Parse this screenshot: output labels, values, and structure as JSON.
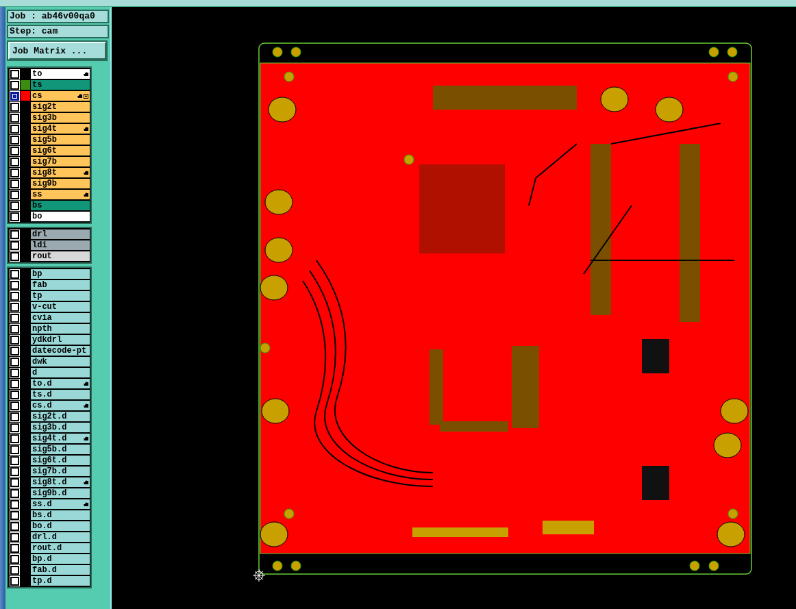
{
  "job": "Job : ab46v00qa0",
  "step": "Step: cam",
  "matrix_button": "Job Matrix ...",
  "layer_groups": [
    {
      "layers": [
        {
          "name": "to",
          "kind": "silk",
          "selected": false,
          "marked": true
        },
        {
          "name": "ts",
          "kind": "mask",
          "selected": false,
          "marked": false,
          "color": "#3c8c12"
        },
        {
          "name": "cs",
          "kind": "signal",
          "selected": true,
          "marked": true,
          "expandable": true,
          "color": "#ff0000"
        },
        {
          "name": "sig2t",
          "kind": "signal",
          "selected": false,
          "marked": false
        },
        {
          "name": "sig3b",
          "kind": "signal",
          "selected": false,
          "marked": false
        },
        {
          "name": "sig4t",
          "kind": "signal",
          "selected": false,
          "marked": true
        },
        {
          "name": "sig5b",
          "kind": "signal",
          "selected": false,
          "marked": false
        },
        {
          "name": "sig6t",
          "kind": "signal",
          "selected": false,
          "marked": false
        },
        {
          "name": "sig7b",
          "kind": "signal",
          "selected": false,
          "marked": false
        },
        {
          "name": "sig8t",
          "kind": "signal",
          "selected": false,
          "marked": true
        },
        {
          "name": "sig9b",
          "kind": "signal",
          "selected": false,
          "marked": false
        },
        {
          "name": "ss",
          "kind": "signal",
          "selected": false,
          "marked": true
        },
        {
          "name": "bs",
          "kind": "mask",
          "selected": false,
          "marked": false
        },
        {
          "name": "bo",
          "kind": "silk",
          "selected": false,
          "marked": false
        }
      ]
    },
    {
      "layers": [
        {
          "name": "drl",
          "kind": "drill",
          "selected": false,
          "marked": false
        },
        {
          "name": "ldi",
          "kind": "drill",
          "selected": false,
          "marked": false
        },
        {
          "name": "rout",
          "kind": "rout",
          "selected": false,
          "marked": false
        }
      ]
    },
    {
      "layers": [
        {
          "name": "bp",
          "kind": "misc",
          "selected": false,
          "marked": false
        },
        {
          "name": "fab",
          "kind": "misc",
          "selected": false,
          "marked": false
        },
        {
          "name": "tp",
          "kind": "misc",
          "selected": false,
          "marked": false
        },
        {
          "name": "v-cut",
          "kind": "misc",
          "selected": false,
          "marked": false
        },
        {
          "name": "cvia",
          "kind": "misc",
          "selected": false,
          "marked": false
        },
        {
          "name": "npth",
          "kind": "misc",
          "selected": false,
          "marked": false
        },
        {
          "name": "ydkdrl",
          "kind": "misc",
          "selected": false,
          "marked": false
        },
        {
          "name": "datecode-pt",
          "kind": "misc",
          "selected": false,
          "marked": false
        },
        {
          "name": "dwk",
          "kind": "misc",
          "selected": false,
          "marked": false
        },
        {
          "name": "d",
          "kind": "misc",
          "selected": false,
          "marked": false
        },
        {
          "name": "to.d",
          "kind": "misc",
          "selected": false,
          "marked": true
        },
        {
          "name": "ts.d",
          "kind": "misc",
          "selected": false,
          "marked": false
        },
        {
          "name": "cs.d",
          "kind": "misc",
          "selected": false,
          "marked": true
        },
        {
          "name": "sig2t.d",
          "kind": "misc",
          "selected": false,
          "marked": false
        },
        {
          "name": "sig3b.d",
          "kind": "misc",
          "selected": false,
          "marked": false
        },
        {
          "name": "sig4t.d",
          "kind": "misc",
          "selected": false,
          "marked": true
        },
        {
          "name": "sig5b.d",
          "kind": "misc",
          "selected": false,
          "marked": false
        },
        {
          "name": "sig6t.d",
          "kind": "misc",
          "selected": false,
          "marked": false
        },
        {
          "name": "sig7b.d",
          "kind": "misc",
          "selected": false,
          "marked": false
        },
        {
          "name": "sig8t.d",
          "kind": "misc",
          "selected": false,
          "marked": true
        },
        {
          "name": "sig9b.d",
          "kind": "misc",
          "selected": false,
          "marked": false
        },
        {
          "name": "ss.d",
          "kind": "misc",
          "selected": false,
          "marked": true
        },
        {
          "name": "bs.d",
          "kind": "misc",
          "selected": false,
          "marked": false
        },
        {
          "name": "bo.d",
          "kind": "misc",
          "selected": false,
          "marked": false
        },
        {
          "name": "drl.d",
          "kind": "misc",
          "selected": false,
          "marked": false
        },
        {
          "name": "rout.d",
          "kind": "misc",
          "selected": false,
          "marked": false
        },
        {
          "name": "bp.d",
          "kind": "misc",
          "selected": false,
          "marked": false
        },
        {
          "name": "fab.d",
          "kind": "misc",
          "selected": false,
          "marked": false
        },
        {
          "name": "tp.d",
          "kind": "misc",
          "selected": false,
          "marked": false
        }
      ]
    }
  ]
}
